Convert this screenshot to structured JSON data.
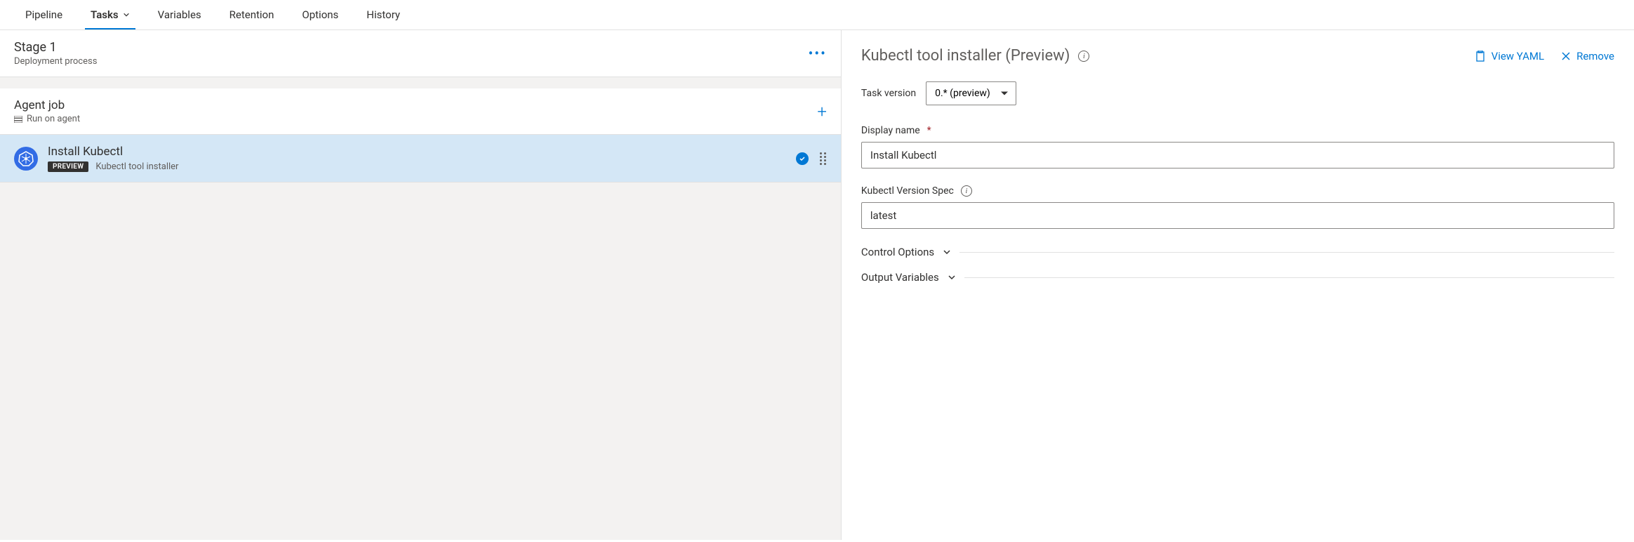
{
  "tabs": {
    "pipeline": "Pipeline",
    "tasks": "Tasks",
    "variables": "Variables",
    "retention": "Retention",
    "options": "Options",
    "history": "History"
  },
  "stage": {
    "title": "Stage 1",
    "subtitle": "Deployment process"
  },
  "job": {
    "title": "Agent job",
    "subtitle": "Run on agent"
  },
  "task": {
    "title": "Install Kubectl",
    "badge": "PREVIEW",
    "subtitle": "Kubectl tool installer"
  },
  "detail": {
    "title": "Kubectl tool installer (Preview)",
    "view_yaml": "View YAML",
    "remove": "Remove",
    "task_version_label": "Task version",
    "task_version_value": "0.* (preview)",
    "display_name_label": "Display name",
    "display_name_value": "Install Kubectl",
    "version_spec_label": "Kubectl Version Spec",
    "version_spec_value": "latest",
    "control_options": "Control Options",
    "output_variables": "Output Variables"
  }
}
